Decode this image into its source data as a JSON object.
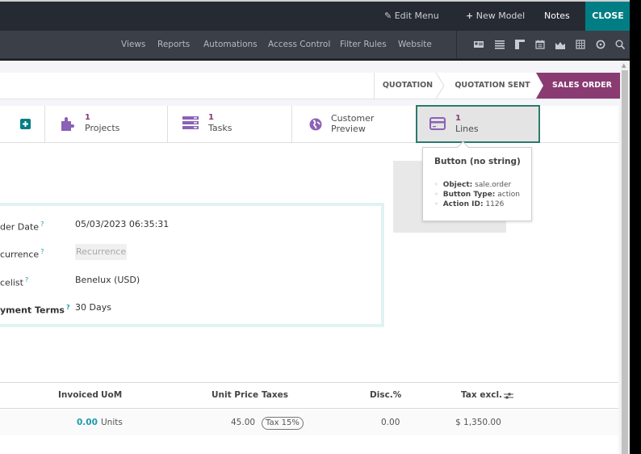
{
  "topbar": {
    "edit_menu": "Edit Menu",
    "new_model": "New Model",
    "notes": "Notes",
    "close": "CLOSE",
    "accent_color": "#017e84"
  },
  "subbar": {
    "links": [
      "Views",
      "Reports",
      "Automations",
      "Access Control",
      "Filter Rules",
      "Website"
    ],
    "view_icons": [
      "form-view-icon",
      "list-view-icon",
      "kanban-view-icon",
      "calendar-view-icon",
      "graph-view-icon",
      "pivot-view-icon",
      "activity-view-icon",
      "search-view-icon"
    ]
  },
  "statusbar": {
    "stages": [
      "QUOTATION",
      "QUOTATION SENT",
      "SALES ORDER"
    ],
    "active_stage": "SALES ORDER",
    "active_color": "#893b72"
  },
  "smart_buttons": {
    "projects": {
      "count": "1",
      "label": "Projects"
    },
    "tasks": {
      "count": "1",
      "label": "Tasks"
    },
    "customer_preview": {
      "line1": "Customer",
      "line2": "Preview"
    },
    "lines": {
      "count": "1",
      "label": "Lines"
    }
  },
  "tooltip": {
    "title": "Button (no string)",
    "object_label": "Object:",
    "object_value": "sale.order",
    "type_label": "Button Type:",
    "type_value": "action",
    "action_label": "Action ID:",
    "action_value": "1126"
  },
  "fields": {
    "order_date": {
      "label": "der Date",
      "value": "05/03/2023 06:35:31"
    },
    "recurrence": {
      "label": "currence",
      "placeholder": "Recurrence"
    },
    "pricelist": {
      "label": "celist",
      "value": "Benelux (USD)"
    },
    "payment_terms": {
      "label": "yment Terms",
      "value": "30 Days"
    },
    "help_mark": "?"
  },
  "order_lines": {
    "columns": [
      "Invoiced",
      "UoM",
      "Unit Price",
      "Taxes",
      "Disc.%",
      "Tax excl."
    ],
    "rows": [
      {
        "invoiced": "0.00",
        "uom": "Units",
        "unit_price": "45.00",
        "taxes": "Tax 15%",
        "discount": "0.00",
        "subtotal": "$ 1,350.00"
      }
    ]
  }
}
